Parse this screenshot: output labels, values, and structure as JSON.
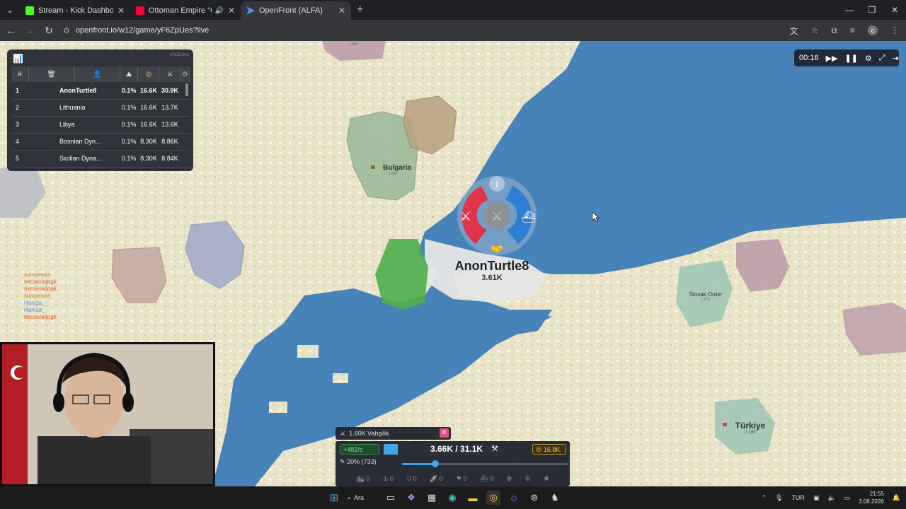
{
  "browser": {
    "tabs": [
      {
        "title": "Stream - Kick Dashboard",
        "color": "#53fc18"
      },
      {
        "title": "Ottoman Empire \"Ceddin D",
        "color": "#ff0033"
      },
      {
        "title": "OpenFront (ALFA)",
        "color": "#4a9be8"
      }
    ],
    "url": "openfront.io/w12/game/yF6ZpUes?live"
  },
  "leaderboard": {
    "game_id": "yF6ZpUes",
    "headers": [
      "#",
      "",
      "",
      "",
      "",
      "",
      ""
    ],
    "rows": [
      {
        "rank": "1",
        "name": "AnonTurtle8",
        "territory": "0.1%",
        "gold": "16.6K",
        "troops": "30.9K"
      },
      {
        "rank": "2",
        "name": "Lithuania",
        "territory": "0.1%",
        "gold": "16.6K",
        "troops": "13.7K"
      },
      {
        "rank": "3",
        "name": "Libya",
        "territory": "0.1%",
        "gold": "16.6K",
        "troops": "13.6K"
      },
      {
        "rank": "4",
        "name": "Bosnian Dyn...",
        "territory": "0.1%",
        "gold": "8.30K",
        "troops": "8.86K"
      },
      {
        "rank": "5",
        "name": "Sicilian Dyna...",
        "territory": "0.1%",
        "gold": "8.30K",
        "troops": "8.84K"
      }
    ]
  },
  "timer": {
    "elapsed": "00:16"
  },
  "map": {
    "player": {
      "name": "AnonTurtle8",
      "troops": "3.61K"
    },
    "labels": [
      {
        "name": "Bulgaria",
        "troops": "1.89K"
      },
      {
        "name": "Slovak Order",
        "troops": "1.87K"
      },
      {
        "name": "Türkiye",
        "troops": "2.18K"
      },
      {
        "name": "",
        "troops": "1.85K"
      }
    ]
  },
  "chat": [
    {
      "user": "survyewss",
      "msg": "rahat rahat olur"
    },
    {
      "user": "necseroqogk",
      "msg": "galiba"
    },
    {
      "user": "necseroqogk",
      "msg": ""
    },
    {
      "user": "survyewss",
      "msg": "olur"
    },
    {
      "user": "Hamza_",
      "msg": ""
    },
    {
      "user": "Hamza_",
      "msg": "bi başla degisin"
    },
    {
      "user": "necseroqogk",
      "msg": ""
    }
  ],
  "control": {
    "attack_label": "1.60K Vahşilik",
    "pop_rate": "+482/s",
    "population": "3.66K / 31.1K",
    "population_fraction": 0.118,
    "gold": "16.8K",
    "attack_ratio": "20% (733)",
    "attack_ratio_fraction": 0.2,
    "buildings": [
      "0",
      "0",
      "0",
      "0",
      "0",
      "0",
      "0",
      "0",
      "0",
      "0",
      "0"
    ]
  },
  "taskbar": {
    "search_label": "Ara",
    "language": "TUR",
    "time": "21:55",
    "date": "3.08.2026"
  }
}
